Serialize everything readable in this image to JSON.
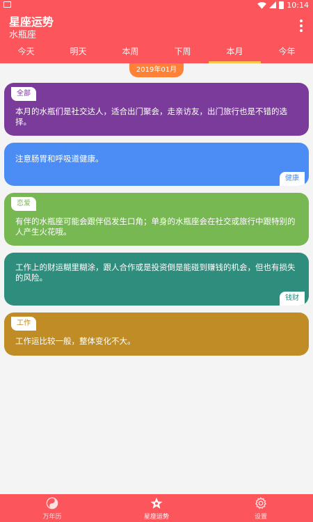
{
  "status_bar": {
    "time": "10:14"
  },
  "header": {
    "title": "星座运势",
    "subtitle": "水瓶座"
  },
  "tabs": [
    {
      "label": "今天"
    },
    {
      "label": "明天"
    },
    {
      "label": "本周"
    },
    {
      "label": "下周"
    },
    {
      "label": "本月",
      "active": true
    },
    {
      "label": "今年"
    }
  ],
  "date_badge": "2019年01月",
  "cards": [
    {
      "tag": "全部",
      "text": "本月的水瓶们是社交达人，适合出门聚会，走亲访友，出门旅行也是不错的选择。",
      "color": "#7a3b9a",
      "tag_color": "#7a3b9a"
    },
    {
      "tag": "健康",
      "text": "注意肠胃和呼吸道健康。",
      "color": "#4c8df5",
      "tag_color": "#4c8df5"
    },
    {
      "tag": "恋爱",
      "text": "有伴的水瓶座可能会跟伴侣发生口角；单身的水瓶座会在社交或旅行中跟特别的人产生火花哦。",
      "color": "#78b853",
      "tag_color": "#78b853"
    },
    {
      "tag": "钱财",
      "text": "工作上的财运糊里糊涂，跟人合作或是投资倒是能碰到赚钱的机会，但也有损失的风险。",
      "color": "#2e8d7c",
      "tag_color": "#2e8d7c"
    },
    {
      "tag": "工作",
      "text": "工作运比较一般，整体变化不大。",
      "color": "#bf8c26",
      "tag_color": "#bf8c26"
    }
  ],
  "bottom_nav": [
    {
      "label": "万年历",
      "icon": "yin-yang-icon"
    },
    {
      "label": "星座运势",
      "icon": "star-icon",
      "active": true
    },
    {
      "label": "设置",
      "icon": "gear-icon"
    }
  ],
  "colors": {
    "primary": "#fc555c",
    "tab_indicator": "#f8c64a",
    "date_badge": "#fd8136",
    "background": "#f4f4f4"
  }
}
